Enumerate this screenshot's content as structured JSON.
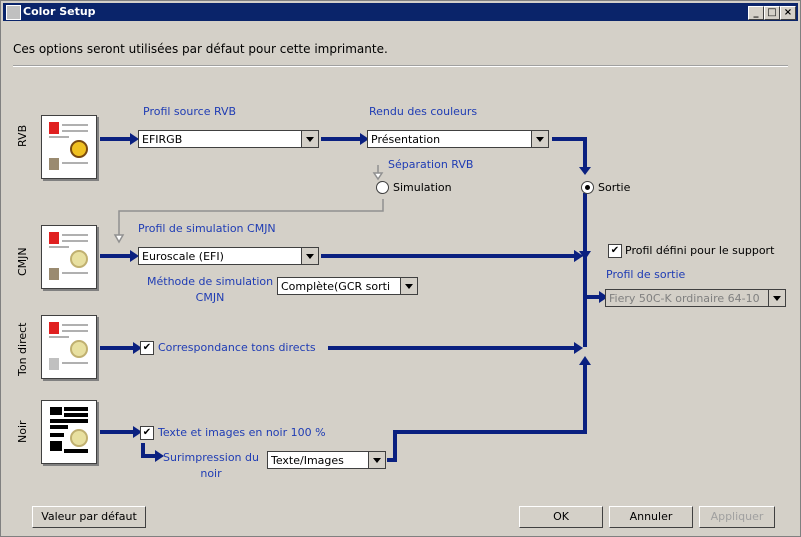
{
  "window": {
    "title": "Color Setup"
  },
  "header": {
    "description": "Ces options seront utilisées par défaut pour cette imprimante."
  },
  "rows": {
    "rvb": "RVB",
    "cmjn": "CMJN",
    "ton_direct": "Ton direct",
    "noir": "Noir"
  },
  "rgb": {
    "source_label": "Profil source RVB",
    "source_value": "EFIRGB",
    "rendering_label": "Rendu des couleurs",
    "rendering_value": "Présentation",
    "separation_label": "Séparation RVB",
    "simulation_option": "Simulation",
    "output_option": "Sortie"
  },
  "cmyk": {
    "sim_profile_label": "Profil de simulation CMJN",
    "sim_profile_value": "Euroscale (EFI)",
    "method_label_line1": "Méthode de simulation",
    "method_label_line2": "CMJN",
    "method_value": "Complète(GCR sorti"
  },
  "spot": {
    "match_label": "Correspondance tons directs",
    "match_checked": true
  },
  "black": {
    "pure_black_label": "Texte et images en noir 100 %",
    "pure_black_checked": true,
    "overprint_label_line1": "Surimpression du",
    "overprint_label_line2": "noir",
    "overprint_value": "Texte/Images"
  },
  "output": {
    "media_profile_label": "Profil défini pour le support",
    "media_profile_checked": true,
    "output_profile_label": "Profil de sortie",
    "output_profile_value": "Fiery 50C-K ordinaire 64-10"
  },
  "buttons": {
    "defaults": "Valeur par défaut",
    "ok": "OK",
    "cancel": "Annuler",
    "apply": "Appliquer"
  },
  "colors": {
    "accent": "#0a246a",
    "label_blue": "#1f3cb4",
    "face": "#d4d0c8"
  }
}
